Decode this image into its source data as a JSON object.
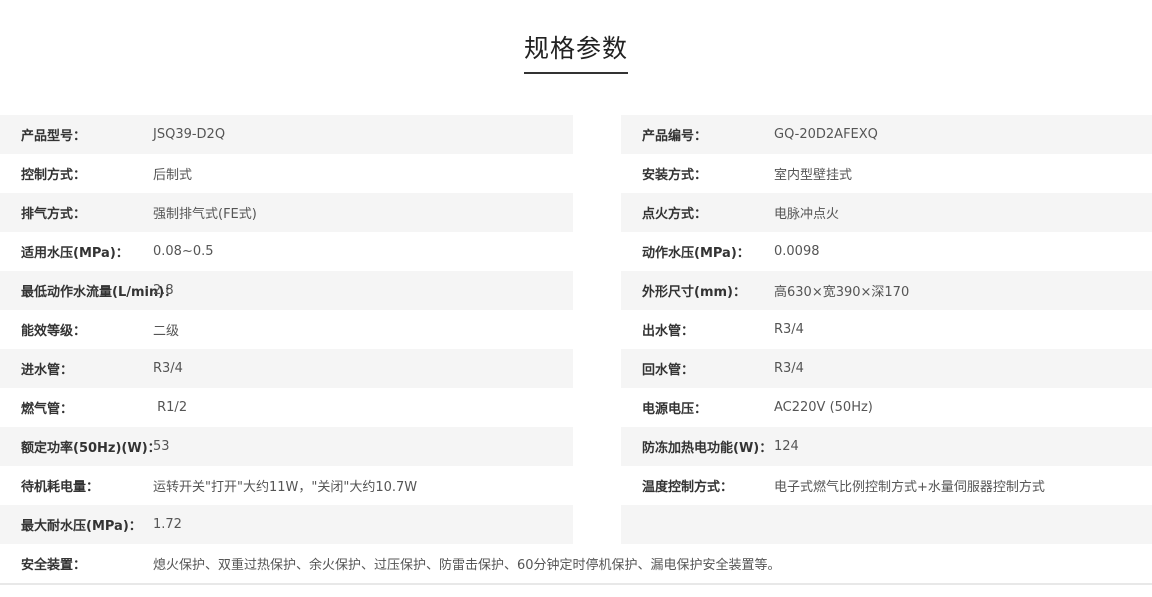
{
  "page": {
    "title": "规格参数"
  },
  "rows": [
    {
      "left": {
        "label": "产品型号：",
        "value": "JSQ39-D2Q"
      },
      "right": {
        "label": "产品编号：",
        "value": "GQ-20D2AFEXQ"
      }
    },
    {
      "left": {
        "label": "控制方式：",
        "value": "后制式"
      },
      "right": {
        "label": "安装方式：",
        "value": "室内型壁挂式"
      }
    },
    {
      "left": {
        "label": "排气方式：",
        "value": "强制排气式(FE式)"
      },
      "right": {
        "label": "点火方式：",
        "value": "电脉冲点火"
      }
    },
    {
      "left": {
        "label": "适用水压(MPa)：",
        "value": "0.08~0.5"
      },
      "right": {
        "label": "动作水压(MPa)：",
        "value": "0.0098"
      }
    },
    {
      "left": {
        "label": "最低动作水流量(L/min)：",
        "value": "2.8"
      },
      "right": {
        "label": "外形尺寸(mm)：",
        "value": "高630×宽390×深170"
      }
    },
    {
      "left": {
        "label": "能效等级：",
        "value": "二级"
      },
      "right": {
        "label": "出水管：",
        "value": "R3/4"
      }
    },
    {
      "left": {
        "label": "进水管：",
        "value": "R3/4"
      },
      "right": {
        "label": "回水管：",
        "value": "R3/4"
      }
    },
    {
      "left": {
        "label": "燃气管：",
        "value": " R1/2"
      },
      "right": {
        "label": "电源电压：",
        "value": "AC220V (50Hz)"
      }
    },
    {
      "left": {
        "label": "额定功率(50Hz)(W)：",
        "value": "53"
      },
      "right": {
        "label": "防冻加热电功能(W)：",
        "value": "124"
      }
    },
    {
      "left": {
        "label": "待机耗电量：",
        "value": "运转开关\"打开\"大约11W，\"关闭\"大约10.7W"
      },
      "right": {
        "label": "温度控制方式：",
        "value": "电子式燃气比例控制方式+水量伺服器控制方式"
      }
    },
    {
      "left": {
        "label": "最大耐水压(MPa)：",
        "value": "1.72"
      },
      "right": {
        "label": "",
        "value": ""
      }
    }
  ],
  "full_row": {
    "label": "安全装置：",
    "value": "熄火保护、双重过热保护、余火保护、过压保护、防雷击保护、60分钟定时停机保护、漏电保护安全装置等。"
  }
}
